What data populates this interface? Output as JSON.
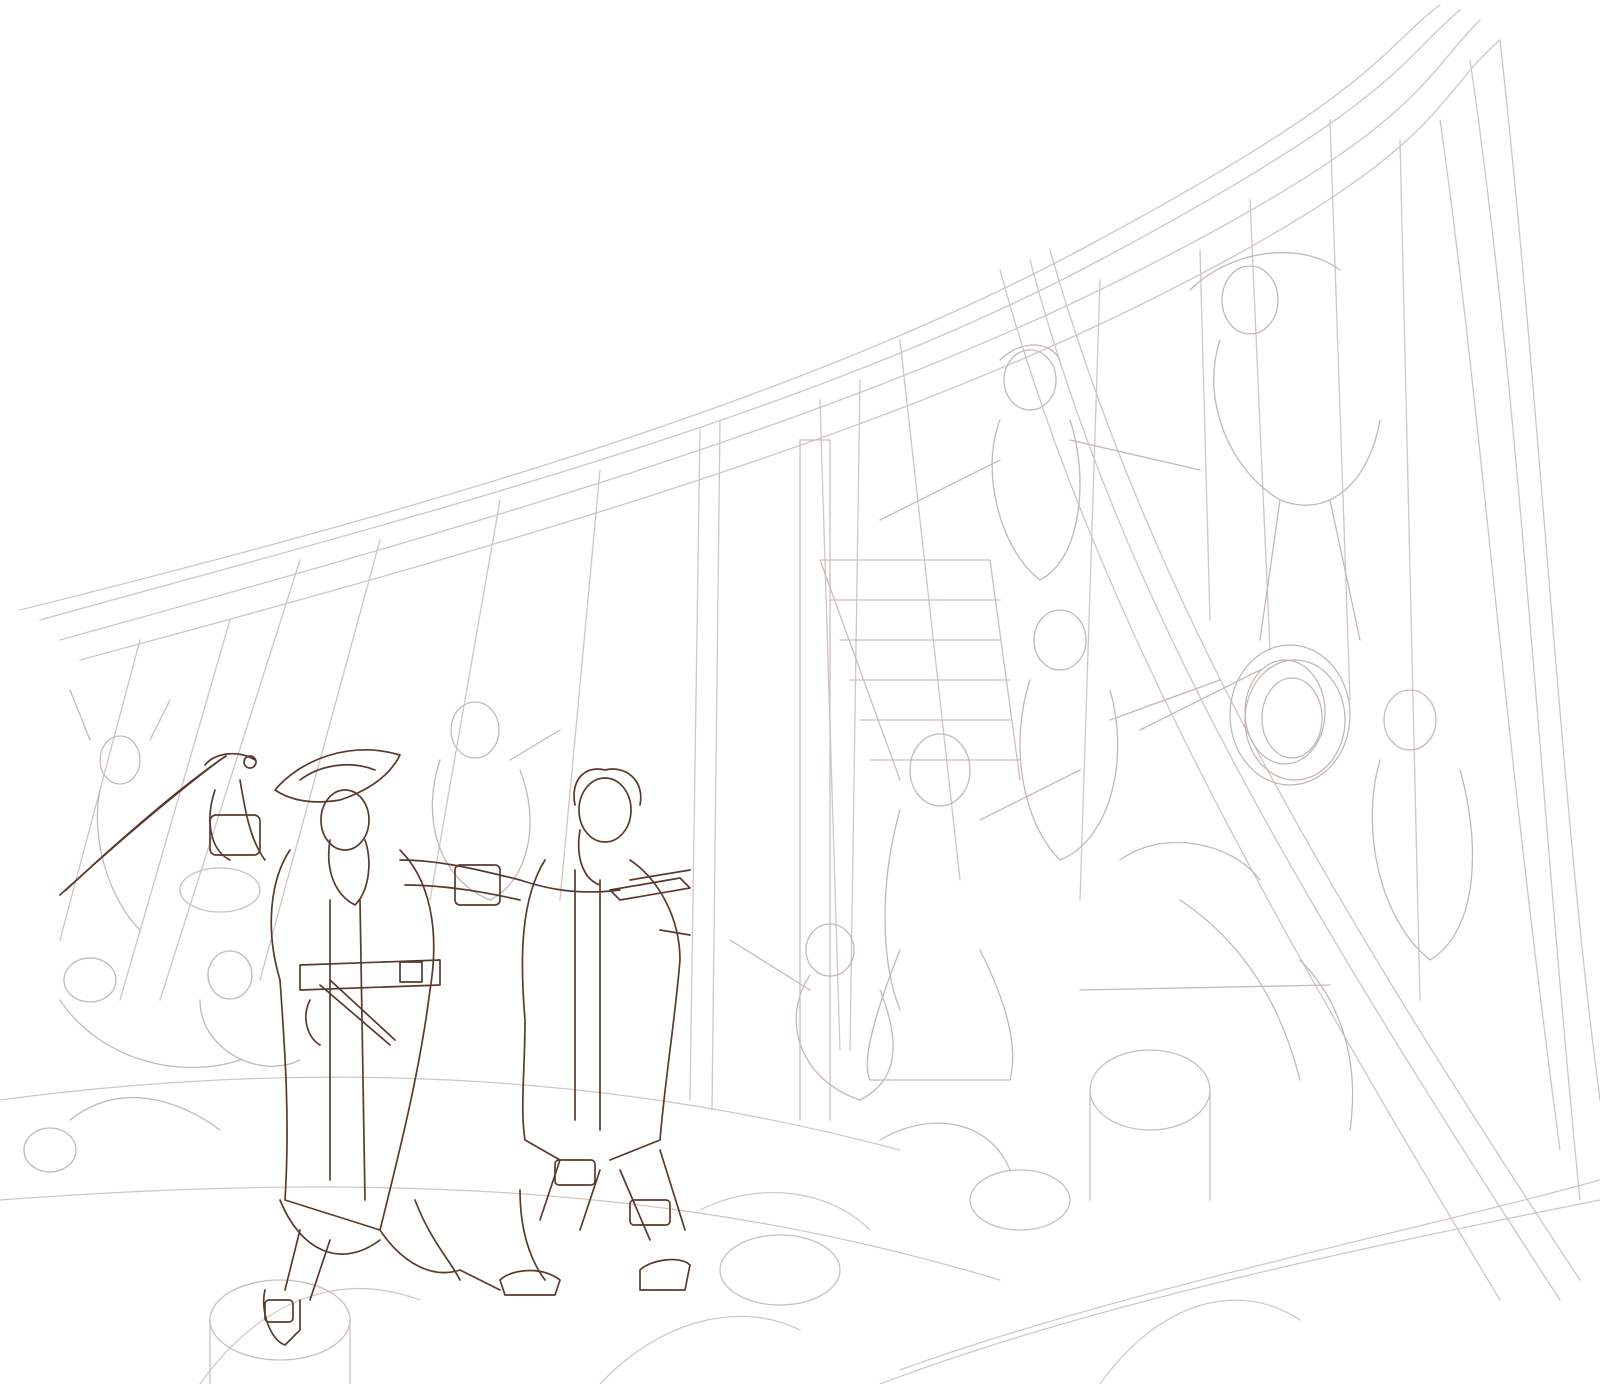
{
  "canvas": {
    "background": "#ffffff",
    "ink_dark": "#5a3a30",
    "ink_light": "#c8bebb"
  }
}
